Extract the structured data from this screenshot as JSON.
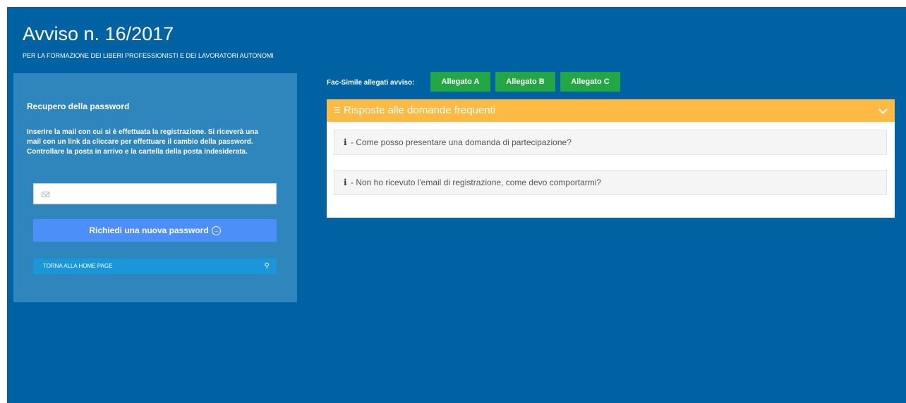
{
  "header": {
    "title": "Avviso n. 16/2017",
    "subtitle": "PER LA FORMAZIONE DEI LIBERI PROFESSIONISTI E DEI LAVORATORI AUTONOMI"
  },
  "password_panel": {
    "heading": "Recupero della password",
    "description": "Inserire la mail con cui si è effettuata la registrazione. Si riceverà una mail con un link da cliccare per effettuare il cambio della password. Controllare la posta in arrivo e la cartella della posta indesiderata.",
    "email_value": "",
    "submit_label": "Richiedi una nuova password",
    "home_link_label": "TORNA ALLA HOME PAGE"
  },
  "attachments": {
    "label": "Fac-Simile allegati avviso:",
    "buttons": [
      "Allegato A",
      "Allegato B",
      "Allegato C"
    ]
  },
  "faq": {
    "title": "Risposte alle domande frequenti",
    "items": [
      "- Come posso presentare una domanda di partecipazione?",
      "- Non ho ricevuto l'email di registrazione, come devo comportarmi?"
    ]
  },
  "colors": {
    "page_background": "#0062a3",
    "panel_background": "#2e86bc",
    "submit_button": "#4d8ff8",
    "home_link": "#1a97db",
    "attachment_button": "#23a744",
    "faq_header": "#ffba44"
  },
  "icons": {
    "email_field": "envelope-icon",
    "submit_button": "arrow-circle-right-icon",
    "home_link": "key-icon",
    "faq_header_left": "menu-icon",
    "faq_header_right": "chevron-down-icon",
    "faq_item": "info-icon"
  }
}
